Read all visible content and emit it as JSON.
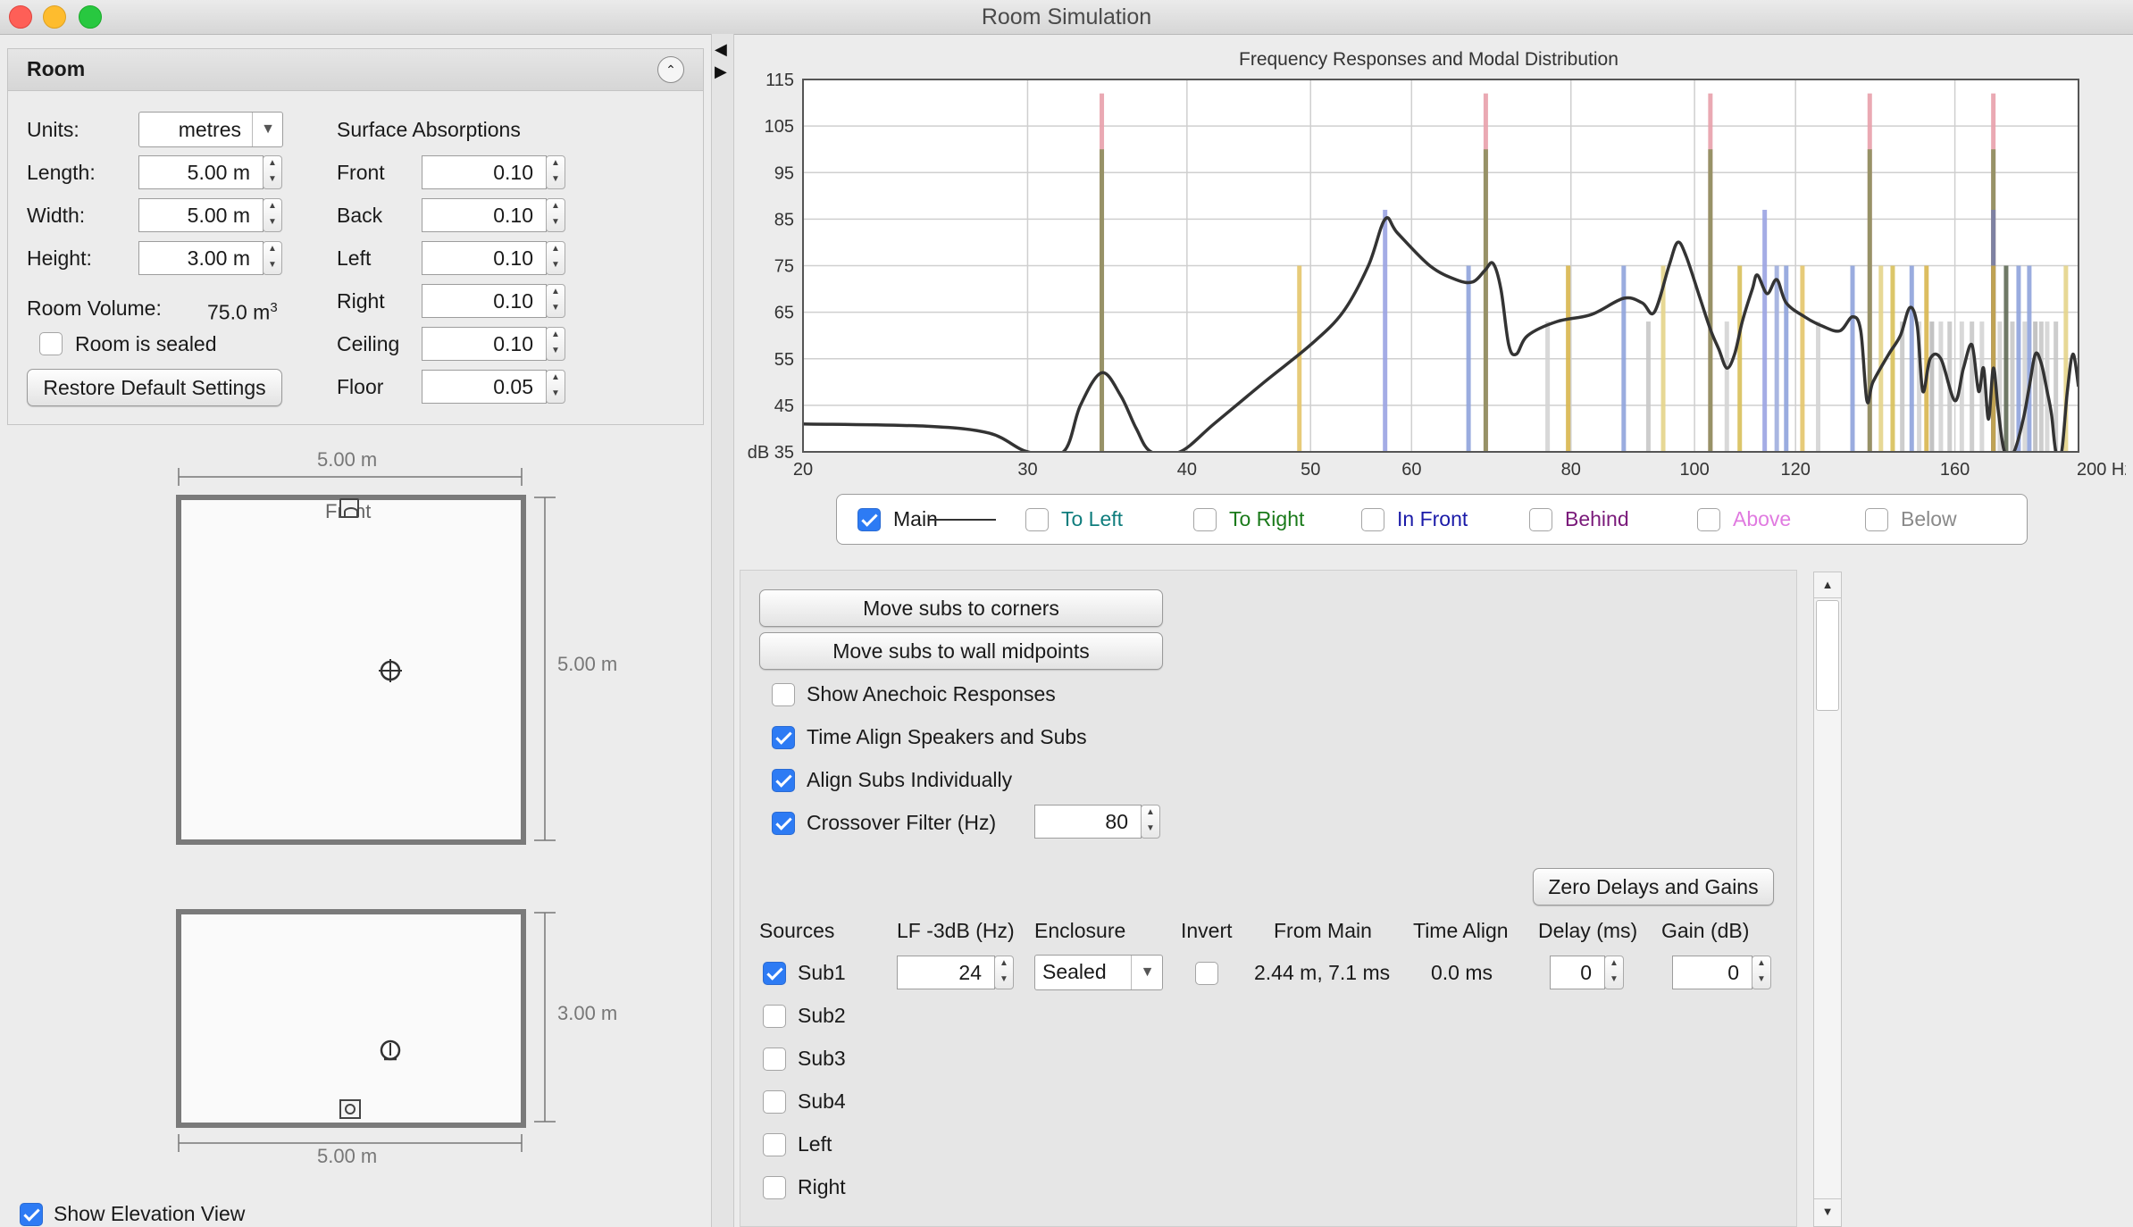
{
  "window": {
    "title": "Room Simulation"
  },
  "room_panel": {
    "header": "Room",
    "units_label": "Units:",
    "units_value": "metres",
    "length_label": "Length:",
    "length_value": "5.00 m",
    "width_label": "Width:",
    "width_value": "5.00 m",
    "height_label": "Height:",
    "height_value": "3.00 m",
    "volume_label": "Room Volume:",
    "volume_value": "75.0 m",
    "volume_unit_sup": "3",
    "sealed_label": "Room is sealed",
    "restore_button": "Restore Default Settings",
    "absorptions_title": "Surface Absorptions",
    "absorptions": [
      {
        "label": "Front",
        "value": "0.10"
      },
      {
        "label": "Back",
        "value": "0.10"
      },
      {
        "label": "Left",
        "value": "0.10"
      },
      {
        "label": "Right",
        "value": "0.10"
      },
      {
        "label": "Ceiling",
        "value": "0.10"
      },
      {
        "label": "Floor",
        "value": "0.05"
      }
    ]
  },
  "plan_view": {
    "width_dim": "5.00 m",
    "depth_dim": "5.00 m",
    "front_label": "Front"
  },
  "elevation_view": {
    "height_dim": "3.00 m",
    "width_dim": "5.00 m"
  },
  "show_elevation_label": "Show Elevation View",
  "chart_data": {
    "type": "line",
    "title": "Frequency Responses and Modal Distribution",
    "x_scale": "log",
    "xlim": [
      20,
      200
    ],
    "ylim": [
      35,
      115
    ],
    "y_ticks": [
      "115",
      "105",
      "95",
      "85",
      "75",
      "65",
      "55",
      "45",
      "dB 35"
    ],
    "x_ticks": [
      {
        "v": 20,
        "t": "20"
      },
      {
        "v": 30,
        "t": "30"
      },
      {
        "v": 40,
        "t": "40"
      },
      {
        "v": 50,
        "t": "50"
      },
      {
        "v": 60,
        "t": "60"
      },
      {
        "v": 80,
        "t": "80"
      },
      {
        "v": 100,
        "t": "100"
      },
      {
        "v": 120,
        "t": "120"
      },
      {
        "v": 160,
        "t": "160"
      },
      {
        "v": 200,
        "t": "200 Hz"
      }
    ],
    "grid": true,
    "series": [
      {
        "name": "Main",
        "color": "#333333",
        "points": [
          [
            20,
            41
          ],
          [
            25,
            40.5
          ],
          [
            28,
            39
          ],
          [
            30,
            35
          ],
          [
            32,
            35
          ],
          [
            33,
            45
          ],
          [
            34.3,
            52
          ],
          [
            35.5,
            47
          ],
          [
            36.5,
            40
          ],
          [
            37.5,
            35
          ],
          [
            39.5,
            35
          ],
          [
            42,
            41
          ],
          [
            46,
            50
          ],
          [
            50,
            58
          ],
          [
            53,
            65
          ],
          [
            55.5,
            75
          ],
          [
            57.2,
            85
          ],
          [
            58.5,
            82
          ],
          [
            62,
            75
          ],
          [
            65,
            72
          ],
          [
            67,
            71.5
          ],
          [
            68.5,
            74
          ],
          [
            69.5,
            75.5
          ],
          [
            70.5,
            70
          ],
          [
            71.5,
            58
          ],
          [
            72.5,
            56
          ],
          [
            74,
            60
          ],
          [
            78,
            63
          ],
          [
            83,
            64.5
          ],
          [
            88,
            68
          ],
          [
            91,
            67
          ],
          [
            93,
            65
          ],
          [
            95.5,
            75
          ],
          [
            97,
            80
          ],
          [
            98.5,
            77
          ],
          [
            101,
            68
          ],
          [
            103,
            61
          ],
          [
            104.5,
            57
          ],
          [
            106,
            53
          ],
          [
            107.5,
            56
          ],
          [
            109,
            63
          ],
          [
            111,
            70
          ],
          [
            112,
            73
          ],
          [
            114,
            69
          ],
          [
            116,
            72
          ],
          [
            118,
            67
          ],
          [
            122,
            64
          ],
          [
            126,
            62
          ],
          [
            130,
            61
          ],
          [
            133,
            64
          ],
          [
            135,
            61
          ],
          [
            136.5,
            46
          ],
          [
            138,
            50
          ],
          [
            142,
            56
          ],
          [
            145,
            60
          ],
          [
            147.5,
            66
          ],
          [
            149.5,
            62
          ],
          [
            151,
            48
          ],
          [
            153,
            55
          ],
          [
            156,
            55
          ],
          [
            160,
            46
          ],
          [
            162.5,
            53
          ],
          [
            165,
            58
          ],
          [
            167,
            48
          ],
          [
            168.5,
            53
          ],
          [
            170,
            42
          ],
          [
            171.5,
            53
          ],
          [
            173,
            44
          ],
          [
            175,
            35
          ],
          [
            178,
            35
          ],
          [
            181,
            42
          ],
          [
            183,
            49
          ],
          [
            185,
            56
          ],
          [
            187,
            54
          ],
          [
            189,
            48
          ],
          [
            190.5,
            43
          ],
          [
            192,
            35
          ],
          [
            194,
            35
          ],
          [
            196,
            48
          ],
          [
            198,
            56
          ],
          [
            200,
            49
          ]
        ]
      }
    ],
    "modes": [
      {
        "f": 34.3,
        "db": 112,
        "color": "#e8a0ab"
      },
      {
        "f": 34.3,
        "db": 100,
        "color": "#8e8f5e"
      },
      {
        "f": 49,
        "db": 75,
        "color": "#e4c56a"
      },
      {
        "f": 57.2,
        "db": 87,
        "color": "#9aa3e2"
      },
      {
        "f": 66.5,
        "db": 75,
        "color": "#8fa3dc"
      },
      {
        "f": 68.6,
        "db": 112,
        "color": "#e8a0ab"
      },
      {
        "f": 68.6,
        "db": 100,
        "color": "#8e8f5e"
      },
      {
        "f": 76.7,
        "db": 63,
        "color": "#d4d4d4"
      },
      {
        "f": 79.6,
        "db": 75,
        "color": "#d8b64e"
      },
      {
        "f": 88,
        "db": 75,
        "color": "#8fa3dc"
      },
      {
        "f": 92,
        "db": 63,
        "color": "#c8c8c8"
      },
      {
        "f": 94.5,
        "db": 75,
        "color": "#e4d48a"
      },
      {
        "f": 102.9,
        "db": 112,
        "color": "#e8a0ab"
      },
      {
        "f": 102.9,
        "db": 100,
        "color": "#8e8f5e"
      },
      {
        "f": 106,
        "db": 63,
        "color": "#d4d4d4"
      },
      {
        "f": 108.5,
        "db": 75,
        "color": "#d8c05a"
      },
      {
        "f": 113.5,
        "db": 87,
        "color": "#9aa3e2"
      },
      {
        "f": 116,
        "db": 75,
        "color": "#a0aede"
      },
      {
        "f": 118,
        "db": 75,
        "color": "#8fa3dc"
      },
      {
        "f": 121.5,
        "db": 75,
        "color": "#e4c56a"
      },
      {
        "f": 125,
        "db": 63,
        "color": "#d4d4d4"
      },
      {
        "f": 133,
        "db": 75,
        "color": "#8fa3dc"
      },
      {
        "f": 137.2,
        "db": 112,
        "color": "#e8a0ab"
      },
      {
        "f": 137.2,
        "db": 100,
        "color": "#8e8f5e"
      },
      {
        "f": 140,
        "db": 75,
        "color": "#e4d48a"
      },
      {
        "f": 143,
        "db": 75,
        "color": "#d8c05a"
      },
      {
        "f": 145.5,
        "db": 63,
        "color": "#c8c8c8"
      },
      {
        "f": 148,
        "db": 75,
        "color": "#8fa3dc"
      },
      {
        "f": 150,
        "db": 63,
        "color": "#d4d4d4"
      },
      {
        "f": 152,
        "db": 75,
        "color": "#d8b64e"
      },
      {
        "f": 153.5,
        "db": 63,
        "color": "#bcbcbc"
      },
      {
        "f": 156,
        "db": 63,
        "color": "#d4d4d4"
      },
      {
        "f": 158.5,
        "db": 63,
        "color": "#c8c8c8"
      },
      {
        "f": 162,
        "db": 63,
        "color": "#d4d4d4"
      },
      {
        "f": 165,
        "db": 63,
        "color": "#c8c8c8"
      },
      {
        "f": 168,
        "db": 63,
        "color": "#d4d4d4"
      },
      {
        "f": 171.5,
        "db": 112,
        "color": "#e8a0ab"
      },
      {
        "f": 171.5,
        "db": 100,
        "color": "#8e8f5e"
      },
      {
        "f": 171.5,
        "db": 87,
        "color": "#7b80a8"
      },
      {
        "f": 171.5,
        "db": 75,
        "color": "#c7a54a"
      },
      {
        "f": 173.5,
        "db": 63,
        "color": "#d4d4d4"
      },
      {
        "f": 175.5,
        "db": 75,
        "color": "#5f6a55"
      },
      {
        "f": 177.5,
        "db": 63,
        "color": "#c8c8c8"
      },
      {
        "f": 179.5,
        "db": 75,
        "color": "#8fa3dc"
      },
      {
        "f": 181.5,
        "db": 63,
        "color": "#d4d4d4"
      },
      {
        "f": 183,
        "db": 75,
        "color": "#8fa3dc"
      },
      {
        "f": 185,
        "db": 63,
        "color": "#bcbcbc"
      },
      {
        "f": 187,
        "db": 63,
        "color": "#c8c8c8"
      },
      {
        "f": 189,
        "db": 63,
        "color": "#d4d4d4"
      },
      {
        "f": 192,
        "db": 63,
        "color": "#c8c8c8"
      },
      {
        "f": 195.5,
        "db": 75,
        "color": "#e4d48a"
      }
    ]
  },
  "legend": [
    {
      "label": "Main",
      "checked": true,
      "color": "#1a1a1a"
    },
    {
      "label": "To Left",
      "checked": false,
      "color": "#0f7d7d"
    },
    {
      "label": "To Right",
      "checked": false,
      "color": "#1a7a1a"
    },
    {
      "label": "In Front",
      "checked": false,
      "color": "#1a1aa8"
    },
    {
      "label": "Behind",
      "checked": false,
      "color": "#7a1a7a"
    },
    {
      "label": "Above",
      "checked": false,
      "color": "#e07ae0"
    },
    {
      "label": "Below",
      "checked": false,
      "color": "#8a8a8a"
    }
  ],
  "controls": {
    "move_corners": "Move subs to corners",
    "move_midpoints": "Move subs to wall midpoints",
    "show_anechoic": "Show Anechoic Responses",
    "time_align": "Time Align Speakers and Subs",
    "align_individually": "Align Subs Individually",
    "crossover_label": "Crossover Filter (Hz)",
    "crossover_value": "80",
    "zero_button": "Zero Delays and Gains"
  },
  "sources_table": {
    "headers": {
      "sources": "Sources",
      "lf": "LF -3dB (Hz)",
      "enclosure": "Enclosure",
      "invert": "Invert",
      "from_main": "From Main",
      "time_align": "Time Align",
      "delay": "Delay (ms)",
      "gain": "Gain (dB)"
    },
    "rows": [
      {
        "name": "Sub1",
        "checked": true,
        "lf": "24",
        "enclosure": "Sealed",
        "from_main": "2.44 m, 7.1 ms",
        "time_align": "0.0 ms",
        "delay": "0",
        "gain": "0"
      },
      {
        "name": "Sub2",
        "checked": false
      },
      {
        "name": "Sub3",
        "checked": false
      },
      {
        "name": "Sub4",
        "checked": false
      },
      {
        "name": "Left",
        "checked": false
      },
      {
        "name": "Right",
        "checked": false
      }
    ]
  }
}
